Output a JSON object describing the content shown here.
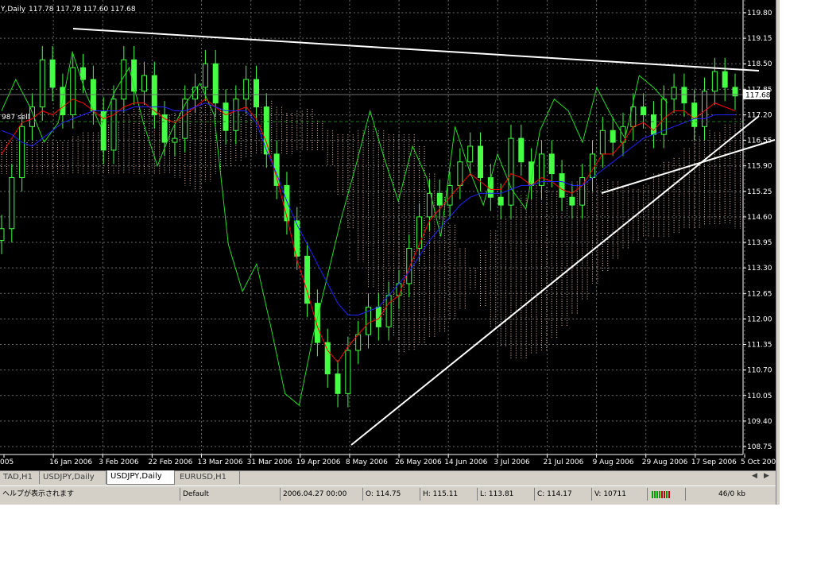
{
  "chart_header": {
    "symbol": "Y,Daily",
    "ohlc": "117.78 117.78 117.60 117.68"
  },
  "order_label": "987 sell",
  "current_price": "117.68",
  "chart_data": {
    "type": "candlestick",
    "price_ticks": [
      "119.80",
      "119.15",
      "118.50",
      "117.85",
      "117.20",
      "116.55",
      "115.90",
      "115.25",
      "114.60",
      "113.95",
      "113.30",
      "112.65",
      "112.00",
      "111.35",
      "110.70",
      "110.05",
      "109.40",
      "108.75"
    ],
    "date_ticks": [
      "005",
      "16 Jan 2006",
      "3 Feb 2006",
      "22 Feb 2006",
      "13 Mar 2006",
      "31 Mar 2006",
      "19 Apr 2006",
      "8 May 2006",
      "26 May 2006",
      "14 Jun 2006",
      "3 Jul 2006",
      "21 Jul 2006",
      "9 Aug 2006",
      "29 Aug 2006",
      "17 Sep 2006",
      "5 Oct 2006"
    ],
    "ylim": [
      108.5,
      120.05
    ],
    "close_series": [
      114.3,
      115.6,
      116.9,
      117.4,
      118.6,
      117.9,
      117.2,
      118.4,
      118.1,
      117.3,
      116.3,
      117.6,
      118.6,
      117.8,
      118.2,
      117.2,
      116.5,
      116.6,
      117.6,
      117.9,
      118.5,
      117.5,
      116.8,
      117.6,
      118.1,
      117.4,
      116.2,
      115.4,
      114.5,
      113.6,
      112.4,
      111.4,
      110.6,
      110.1,
      111.2,
      111.6,
      112.3,
      111.8,
      112.6,
      112.9,
      113.8,
      114.6,
      115.2,
      114.9,
      115.4,
      116.0,
      116.4,
      115.6,
      115.1,
      114.9,
      116.6,
      116.0,
      115.4,
      116.2,
      115.7,
      115.1,
      114.9,
      115.6,
      116.2,
      116.8,
      116.5,
      116.9,
      117.4,
      117.2,
      116.7,
      117.6,
      117.9,
      117.5,
      116.9,
      117.8,
      118.3,
      117.9,
      117.68
    ],
    "tenkan_series": [
      116.2,
      116.6,
      117.0,
      117.1,
      117.3,
      117.2,
      117.4,
      117.6,
      117.5,
      117.3,
      117.1,
      117.2,
      117.4,
      117.5,
      117.5,
      117.3,
      117.1,
      117.0,
      117.2,
      117.4,
      117.6,
      117.4,
      117.2,
      117.3,
      117.4,
      117.1,
      116.5,
      115.6,
      114.6,
      113.5,
      112.7,
      111.8,
      111.2,
      110.9,
      111.3,
      111.6,
      111.9,
      112.0,
      112.4,
      112.6,
      113.3,
      113.9,
      114.5,
      114.8,
      115.1,
      115.4,
      115.7,
      115.5,
      115.3,
      115.3,
      115.7,
      115.6,
      115.4,
      115.6,
      115.5,
      115.3,
      115.2,
      115.4,
      115.8,
      116.2,
      116.2,
      116.5,
      116.9,
      117.0,
      116.8,
      117.1,
      117.3,
      117.3,
      117.1,
      117.3,
      117.5,
      117.4,
      117.3
    ],
    "kijun_series": [
      116.8,
      116.7,
      116.5,
      116.4,
      116.6,
      116.8,
      117.0,
      117.1,
      117.2,
      117.3,
      117.3,
      117.3,
      117.3,
      117.4,
      117.4,
      117.4,
      117.4,
      117.3,
      117.3,
      117.4,
      117.5,
      117.4,
      117.3,
      117.3,
      117.3,
      117.0,
      116.3,
      115.7,
      115.0,
      114.4,
      113.9,
      113.4,
      112.9,
      112.4,
      112.1,
      112.1,
      112.2,
      112.3,
      112.6,
      112.9,
      113.2,
      113.6,
      114.0,
      114.3,
      114.6,
      114.9,
      115.1,
      115.2,
      115.2,
      115.2,
      115.3,
      115.4,
      115.4,
      115.5,
      115.5,
      115.5,
      115.4,
      115.4,
      115.6,
      115.8,
      116.0,
      116.2,
      116.4,
      116.6,
      116.7,
      116.8,
      116.9,
      117.0,
      117.1,
      117.1,
      117.2,
      117.2,
      117.2
    ],
    "chikou_series": [
      117.3,
      118.1,
      117.4,
      116.5,
      117.0,
      118.8,
      117.7,
      116.9,
      117.8,
      118.4,
      117.0,
      115.9,
      116.8,
      117.5,
      118.0,
      117.2,
      113.9,
      112.7,
      113.4,
      111.8,
      110.1,
      109.8,
      111.6,
      113.1,
      114.6,
      115.9,
      117.3,
      116.1,
      115.0,
      116.4,
      115.6,
      114.1,
      116.9,
      115.8,
      114.9,
      116.2,
      115.3,
      114.8,
      116.8,
      117.6,
      117.3,
      116.5,
      117.9,
      117.2,
      116.6,
      118.2,
      117.9,
      117.5
    ]
  }
}
